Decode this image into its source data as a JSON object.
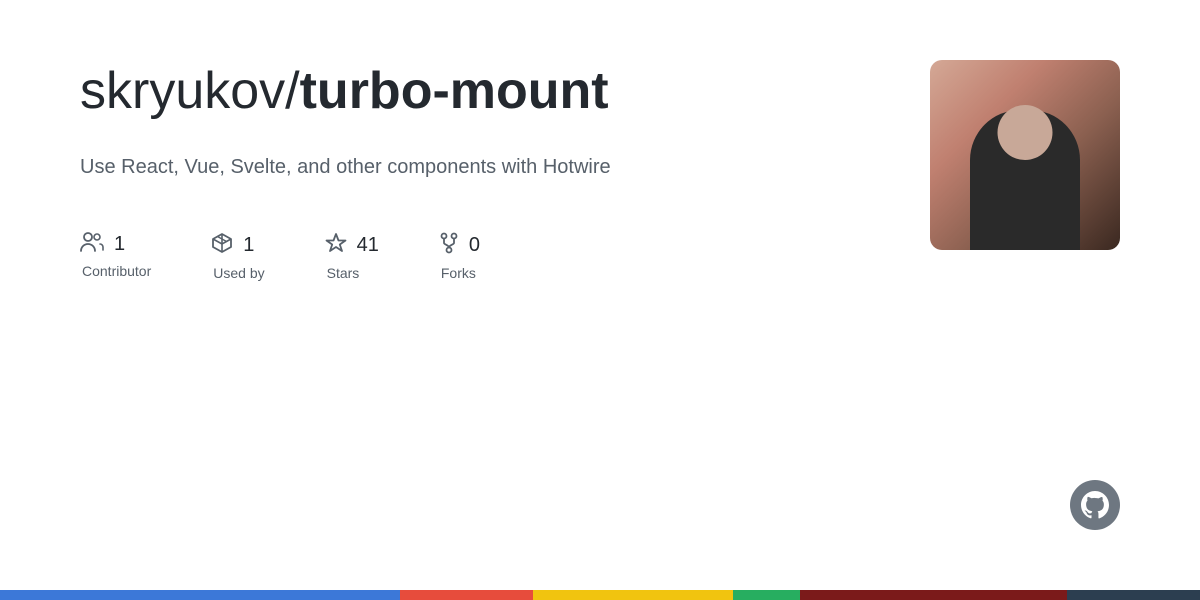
{
  "repo": {
    "username": "skryukov/",
    "reponame": "turbo-mount",
    "description": "Use React, Vue, Svelte, and other components with Hotwire"
  },
  "stats": [
    {
      "id": "contributors",
      "count": "1",
      "label": "Contributor",
      "icon": "people-icon"
    },
    {
      "id": "used-by",
      "count": "1",
      "label": "Used by",
      "icon": "package-icon"
    },
    {
      "id": "stars",
      "count": "41",
      "label": "Stars",
      "icon": "star-icon"
    },
    {
      "id": "forks",
      "count": "0",
      "label": "Forks",
      "icon": "fork-icon"
    }
  ],
  "github": {
    "icon": "octocat-icon"
  },
  "bottom_bar": {
    "colors": [
      "#3c78d8",
      "#e74c3c",
      "#f1c40f",
      "#2ecc71",
      "#7b1a1a",
      "#2c3e50"
    ]
  }
}
